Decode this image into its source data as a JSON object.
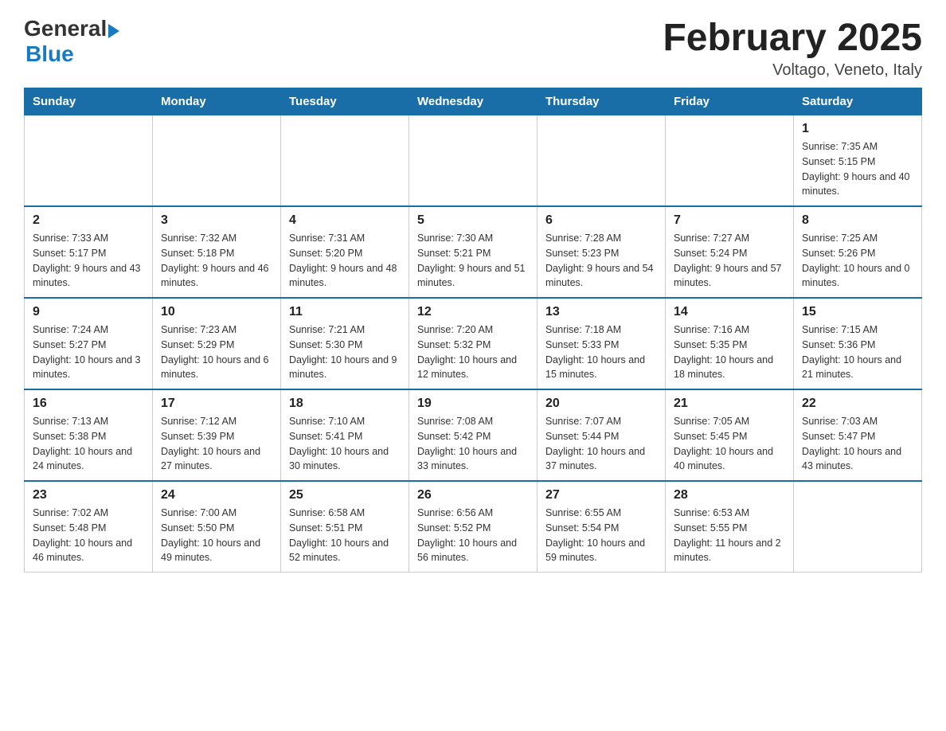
{
  "header": {
    "logo": {
      "general": "General",
      "blue": "Blue",
      "line2": "Blue"
    },
    "title": "February 2025",
    "location": "Voltago, Veneto, Italy"
  },
  "weekdays": [
    "Sunday",
    "Monday",
    "Tuesday",
    "Wednesday",
    "Thursday",
    "Friday",
    "Saturday"
  ],
  "weeks": [
    [
      {
        "day": "",
        "info": ""
      },
      {
        "day": "",
        "info": ""
      },
      {
        "day": "",
        "info": ""
      },
      {
        "day": "",
        "info": ""
      },
      {
        "day": "",
        "info": ""
      },
      {
        "day": "",
        "info": ""
      },
      {
        "day": "1",
        "info": "Sunrise: 7:35 AM\nSunset: 5:15 PM\nDaylight: 9 hours and 40 minutes."
      }
    ],
    [
      {
        "day": "2",
        "info": "Sunrise: 7:33 AM\nSunset: 5:17 PM\nDaylight: 9 hours and 43 minutes."
      },
      {
        "day": "3",
        "info": "Sunrise: 7:32 AM\nSunset: 5:18 PM\nDaylight: 9 hours and 46 minutes."
      },
      {
        "day": "4",
        "info": "Sunrise: 7:31 AM\nSunset: 5:20 PM\nDaylight: 9 hours and 48 minutes."
      },
      {
        "day": "5",
        "info": "Sunrise: 7:30 AM\nSunset: 5:21 PM\nDaylight: 9 hours and 51 minutes."
      },
      {
        "day": "6",
        "info": "Sunrise: 7:28 AM\nSunset: 5:23 PM\nDaylight: 9 hours and 54 minutes."
      },
      {
        "day": "7",
        "info": "Sunrise: 7:27 AM\nSunset: 5:24 PM\nDaylight: 9 hours and 57 minutes."
      },
      {
        "day": "8",
        "info": "Sunrise: 7:25 AM\nSunset: 5:26 PM\nDaylight: 10 hours and 0 minutes."
      }
    ],
    [
      {
        "day": "9",
        "info": "Sunrise: 7:24 AM\nSunset: 5:27 PM\nDaylight: 10 hours and 3 minutes."
      },
      {
        "day": "10",
        "info": "Sunrise: 7:23 AM\nSunset: 5:29 PM\nDaylight: 10 hours and 6 minutes."
      },
      {
        "day": "11",
        "info": "Sunrise: 7:21 AM\nSunset: 5:30 PM\nDaylight: 10 hours and 9 minutes."
      },
      {
        "day": "12",
        "info": "Sunrise: 7:20 AM\nSunset: 5:32 PM\nDaylight: 10 hours and 12 minutes."
      },
      {
        "day": "13",
        "info": "Sunrise: 7:18 AM\nSunset: 5:33 PM\nDaylight: 10 hours and 15 minutes."
      },
      {
        "day": "14",
        "info": "Sunrise: 7:16 AM\nSunset: 5:35 PM\nDaylight: 10 hours and 18 minutes."
      },
      {
        "day": "15",
        "info": "Sunrise: 7:15 AM\nSunset: 5:36 PM\nDaylight: 10 hours and 21 minutes."
      }
    ],
    [
      {
        "day": "16",
        "info": "Sunrise: 7:13 AM\nSunset: 5:38 PM\nDaylight: 10 hours and 24 minutes."
      },
      {
        "day": "17",
        "info": "Sunrise: 7:12 AM\nSunset: 5:39 PM\nDaylight: 10 hours and 27 minutes."
      },
      {
        "day": "18",
        "info": "Sunrise: 7:10 AM\nSunset: 5:41 PM\nDaylight: 10 hours and 30 minutes."
      },
      {
        "day": "19",
        "info": "Sunrise: 7:08 AM\nSunset: 5:42 PM\nDaylight: 10 hours and 33 minutes."
      },
      {
        "day": "20",
        "info": "Sunrise: 7:07 AM\nSunset: 5:44 PM\nDaylight: 10 hours and 37 minutes."
      },
      {
        "day": "21",
        "info": "Sunrise: 7:05 AM\nSunset: 5:45 PM\nDaylight: 10 hours and 40 minutes."
      },
      {
        "day": "22",
        "info": "Sunrise: 7:03 AM\nSunset: 5:47 PM\nDaylight: 10 hours and 43 minutes."
      }
    ],
    [
      {
        "day": "23",
        "info": "Sunrise: 7:02 AM\nSunset: 5:48 PM\nDaylight: 10 hours and 46 minutes."
      },
      {
        "day": "24",
        "info": "Sunrise: 7:00 AM\nSunset: 5:50 PM\nDaylight: 10 hours and 49 minutes."
      },
      {
        "day": "25",
        "info": "Sunrise: 6:58 AM\nSunset: 5:51 PM\nDaylight: 10 hours and 52 minutes."
      },
      {
        "day": "26",
        "info": "Sunrise: 6:56 AM\nSunset: 5:52 PM\nDaylight: 10 hours and 56 minutes."
      },
      {
        "day": "27",
        "info": "Sunrise: 6:55 AM\nSunset: 5:54 PM\nDaylight: 10 hours and 59 minutes."
      },
      {
        "day": "28",
        "info": "Sunrise: 6:53 AM\nSunset: 5:55 PM\nDaylight: 11 hours and 2 minutes."
      },
      {
        "day": "",
        "info": ""
      }
    ]
  ]
}
